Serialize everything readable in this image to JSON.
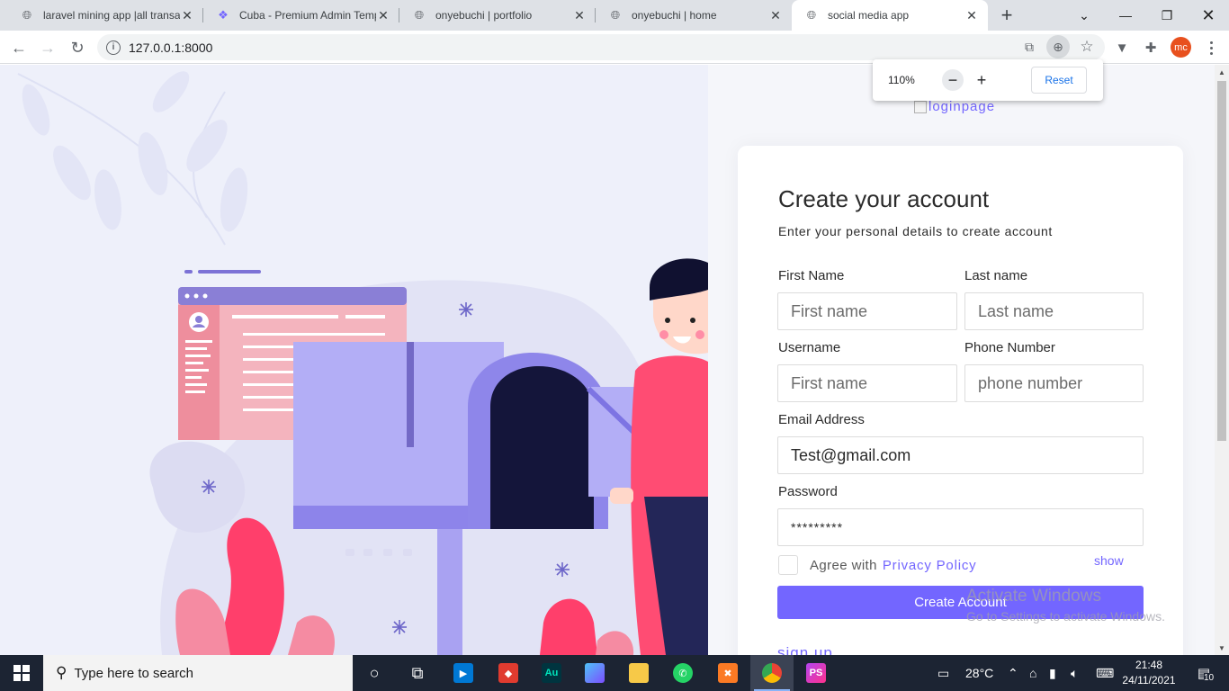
{
  "browser": {
    "tabs": [
      {
        "title": "laravel mining app |all transa",
        "icon": "globe-icon"
      },
      {
        "title": "Cuba - Premium Admin Temp",
        "icon": "cuba-logo-icon"
      },
      {
        "title": "onyebuchi | portfolio",
        "icon": "globe-icon"
      },
      {
        "title": "onyebuchi | home",
        "icon": "globe-icon"
      },
      {
        "title": "social media app",
        "icon": "globe-icon"
      }
    ],
    "url": "127.0.0.1:8000",
    "profile_initials": "mc",
    "zoom": {
      "level": "110%",
      "reset_label": "Reset"
    }
  },
  "page": {
    "logo_alt": "loginpage",
    "title": "Create your account",
    "subtitle": "Enter your personal details to create account",
    "fields": {
      "first_name": {
        "label": "First Name",
        "placeholder": "First name"
      },
      "last_name": {
        "label": "Last name",
        "placeholder": "Last name"
      },
      "username": {
        "label": "Username",
        "placeholder": "First name"
      },
      "phone": {
        "label": "Phone Number",
        "placeholder": "phone number"
      },
      "email": {
        "label": "Email Address",
        "value": "Test@gmail.com"
      },
      "password": {
        "label": "Password",
        "value": "*********"
      }
    },
    "agree_text": "Agree with",
    "privacy_link": "Privacy Policy",
    "show_link": "show",
    "submit_label": "Create Account",
    "signup_link": "sign up"
  },
  "watermark": {
    "line1": "Activate Windows",
    "line2": "Go to Settings to activate Windows."
  },
  "taskbar": {
    "search_placeholder": "Type here to search",
    "temperature": "28°C",
    "time": "21:48",
    "date": "24/11/2021",
    "notification_count": "10"
  },
  "colors": {
    "accent": "#7366ff",
    "tab_bar": "#dee1e6",
    "taskbar": "#1c2433"
  }
}
